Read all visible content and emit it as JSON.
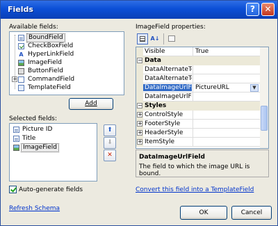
{
  "window": {
    "title": "Fields",
    "help_glyph": "?",
    "close_glyph": "✕"
  },
  "available": {
    "label": "Available fields:",
    "items": [
      {
        "label": "BoundField",
        "icon": "bound-field-icon",
        "selected": true
      },
      {
        "label": "CheckBoxField",
        "icon": "checkbox-field-icon"
      },
      {
        "label": "HyperLinkField",
        "icon": "hyperlink-field-icon"
      },
      {
        "label": "ImageField",
        "icon": "image-field-icon"
      },
      {
        "label": "ButtonField",
        "icon": "button-field-icon"
      },
      {
        "label": "CommandField",
        "icon": "command-field-icon",
        "expandable": true
      },
      {
        "label": "TemplateField",
        "icon": "template-field-icon"
      }
    ],
    "add_label": "Add"
  },
  "selected": {
    "label": "Selected fields:",
    "items": [
      {
        "label": "Picture ID",
        "icon": "bound-field-icon"
      },
      {
        "label": "Title",
        "icon": "bound-field-icon"
      },
      {
        "label": "ImageField",
        "icon": "image-field-icon",
        "selected": true
      }
    ],
    "up_glyph": "⬆",
    "down_glyph": "⬇",
    "delete_glyph": "✕"
  },
  "auto_generate": {
    "label": "Auto-generate fields",
    "checked": true
  },
  "refresh_label": "Refresh Schema",
  "properties": {
    "label": "ImageField properties:",
    "rows": [
      {
        "kind": "prop",
        "name": "Visible",
        "value": "True"
      },
      {
        "kind": "cat",
        "name": "Data",
        "expander": "−"
      },
      {
        "kind": "prop",
        "name": "DataAlternateTextF",
        "value": ""
      },
      {
        "kind": "prop",
        "name": "DataAlternateTextF",
        "value": ""
      },
      {
        "kind": "prop",
        "name": "DataImageUrlField",
        "value": "PictureURL",
        "selected": true
      },
      {
        "kind": "prop",
        "name": "DataImageUrlForma",
        "value": ""
      },
      {
        "kind": "cat",
        "name": "Styles",
        "expander": "−"
      },
      {
        "kind": "prop",
        "name": "ControlStyle",
        "value": "",
        "expander": "+"
      },
      {
        "kind": "prop",
        "name": "FooterStyle",
        "value": "",
        "expander": "+"
      },
      {
        "kind": "prop",
        "name": "HeaderStyle",
        "value": "",
        "expander": "+"
      },
      {
        "kind": "prop",
        "name": "ItemStyle",
        "value": "",
        "expander": "+"
      }
    ],
    "description_title": "DataImageUrlField",
    "description_text": "The field to which the image URL is bound."
  },
  "convert_link": "Convert this field into a TemplateField",
  "ok_label": "OK",
  "cancel_label": "Cancel",
  "colors": {
    "titlebar": "#0b4fd6",
    "selection": "#316ac5",
    "link": "#0033cc",
    "delete": "#cc2200"
  }
}
